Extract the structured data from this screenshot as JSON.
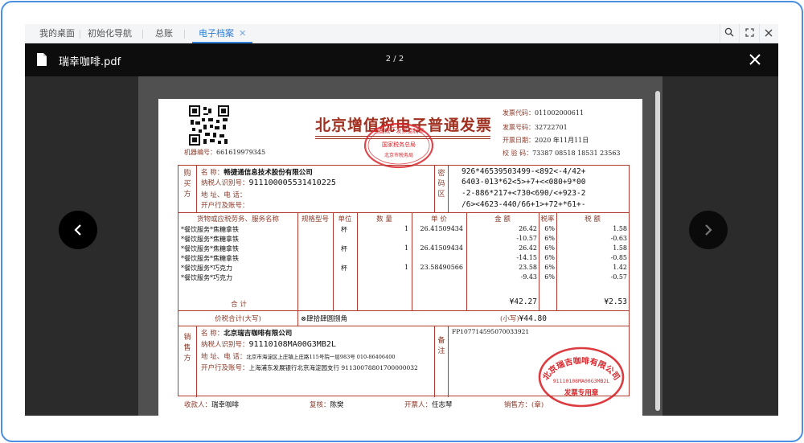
{
  "tabs": [
    {
      "label": "我的桌面"
    },
    {
      "label": "初始化导航"
    },
    {
      "label": "总账"
    },
    {
      "label": "电子档案"
    }
  ],
  "tab_close_glyph": "✕",
  "toolbar_icons": [
    "search-icon",
    "fullscreen-icon",
    "close-icon"
  ],
  "viewer": {
    "file_name": "瑞幸咖啡.pdf",
    "page_indicator": "2 / 2"
  },
  "invoice": {
    "title": "北京增值税电子普通发票",
    "machine_label": "机器编号：",
    "machine_no": "661619979345",
    "code_label": "发票代码：",
    "code": "011002000611",
    "number_label": "发票号码：",
    "number": "32722701",
    "date_label": "开票日期：",
    "date": "2020 年11月11日",
    "check_label": "校  验  码：",
    "check": "73387 08518 18531 23563",
    "buyer_section": "购买方",
    "buyer": {
      "name_label": "名        称：",
      "name": "畅捷通信息技术股份有限公司",
      "tax_label": "纳税人识别号：",
      "tax_id": "911100005531410225",
      "addr_label": "地  址、电  话：",
      "bank_label": "开户行及账号："
    },
    "cipher_section": "密码区",
    "cipher": [
      "926*46539503499-<892<-4/42+",
      "6403-013*62<5>+7+<<080+9*00",
      "-2-886*217+<730<690/<+923-2",
      "/6><4623-440/66+1>+72+*61+-"
    ],
    "headers": {
      "goods": "货物或应税劳务、服务名称",
      "spec": "规格型号",
      "unit": "单位",
      "qty": "数  量",
      "price": "单  价",
      "amount": "金      额",
      "rate": "税率",
      "tax": "税      额"
    },
    "items": [
      {
        "name": "*餐饮服务*焦糖拿铁",
        "unit": "杯",
        "qty": "1",
        "price": "26.41509434",
        "amount": "26.42",
        "rate": "6%",
        "tax": "1.58"
      },
      {
        "name": "*餐饮服务*焦糖拿铁",
        "unit": "",
        "qty": "",
        "price": "",
        "amount": "-10.57",
        "rate": "6%",
        "tax": "-0.63"
      },
      {
        "name": "*餐饮服务*焦糖拿铁",
        "unit": "杯",
        "qty": "1",
        "price": "26.41509434",
        "amount": "26.42",
        "rate": "6%",
        "tax": "1.58"
      },
      {
        "name": "*餐饮服务*焦糖拿铁",
        "unit": "",
        "qty": "",
        "price": "",
        "amount": "-14.15",
        "rate": "6%",
        "tax": "-0.85"
      },
      {
        "name": "*餐饮服务*巧克力",
        "unit": "杯",
        "qty": "1",
        "price": "23.58490566",
        "amount": "23.58",
        "rate": "6%",
        "tax": "1.42"
      },
      {
        "name": "*餐饮服务*巧克力",
        "unit": "",
        "qty": "",
        "price": "",
        "amount": "-9.43",
        "rate": "6%",
        "tax": "-0.57"
      }
    ],
    "total_label": "合        计",
    "total_amount": "¥42.27",
    "total_tax": "¥2.53",
    "grand_label": "价税合计(大写)",
    "grand_upper": "⊗肆拾肆圆捌角",
    "grand_small_label": "(小写)",
    "grand_small": "¥44.80",
    "seller_section": "销售方",
    "seller": {
      "name_label": "名        称：",
      "name": "北京瑞吉咖啡有限公司",
      "tax_label": "纳税人识别号：",
      "tax_id": "91110108MA00G3MB2L",
      "addr_label": "地  址、电  话：",
      "addr": "北京市海淀区上庄镇上庄路115号院一层983号 010-86406400",
      "bank_label": "开户行及账号：",
      "bank": "上海浦东发展银行北京海淀园支行 91130078801700000032"
    },
    "remark_section": "备注",
    "remark": "FP107714595070033921",
    "payee_label": "收款人：",
    "payee": "瑞幸咖啡",
    "reviewer_label": "复核：",
    "reviewer": "陈樊",
    "drawer_label": "开票人：",
    "drawer": "任志琴",
    "seller_sign_label": "销售方：(章)",
    "stamp1_text": "全国统一发票监制章",
    "stamp1_sub": "国家税务总局",
    "stamp1_bottom": "北京市税务局",
    "stamp2_text": "北京瑞吉咖啡有限公司",
    "stamp2_id": "91110108MA00G3MB2L",
    "stamp2_bottom": "发票专用章"
  }
}
